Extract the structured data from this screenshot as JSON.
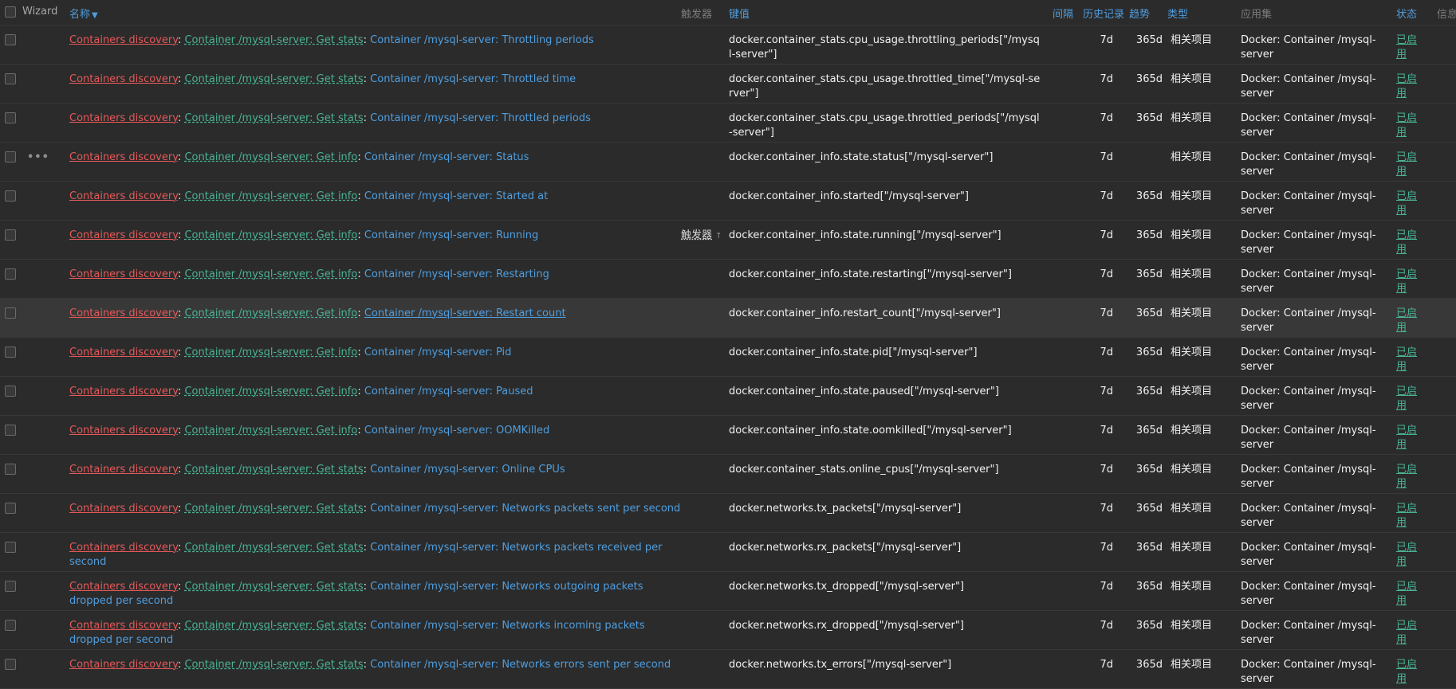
{
  "headers": {
    "wizard": "Wizard",
    "name": "名称",
    "triggers": "触发器",
    "key": "键值",
    "interval": "间隔",
    "history": "历史记录",
    "trends": "趋势",
    "type": "类型",
    "application": "应用集",
    "status": "状态",
    "info": "信息"
  },
  "colors": {
    "discovery": "#e45959",
    "master": "#4ab294",
    "link": "#4f9edf",
    "status": "#4ab294",
    "background": "#2b2b2b"
  },
  "rows": [
    {
      "discovery": "Containers discovery",
      "master": "Container /mysql-server: Get stats",
      "name": "Container /mysql-server: Throttling periods",
      "triggers": "",
      "key": "docker.container_stats.cpu_usage.throttling_periods[\"/mysql-server\"]",
      "history": "7d",
      "trends": "365d",
      "type": "相关项目",
      "app": "Docker: Container /mysql-server",
      "status": "已启用"
    },
    {
      "discovery": "Containers discovery",
      "master": "Container /mysql-server: Get stats",
      "name": "Container /mysql-server: Throttled time",
      "triggers": "",
      "key": "docker.container_stats.cpu_usage.throttled_time[\"/mysql-server\"]",
      "history": "7d",
      "trends": "365d",
      "type": "相关项目",
      "app": "Docker: Container /mysql-server",
      "status": "已启用"
    },
    {
      "discovery": "Containers discovery",
      "master": "Container /mysql-server: Get stats",
      "name": "Container /mysql-server: Throttled periods",
      "triggers": "",
      "key": "docker.container_stats.cpu_usage.throttled_periods[\"/mysql-server\"]",
      "history": "7d",
      "trends": "365d",
      "type": "相关项目",
      "app": "Docker: Container /mysql-server",
      "status": "已启用"
    },
    {
      "discovery": "Containers discovery",
      "master": "Container /mysql-server: Get info",
      "name": "Container /mysql-server: Status",
      "triggers": "",
      "key": "docker.container_info.state.status[\"/mysql-server\"]",
      "history": "7d",
      "trends": "",
      "type": "相关项目",
      "app": "Docker: Container /mysql-server",
      "status": "已启用",
      "dots": "•••"
    },
    {
      "discovery": "Containers discovery",
      "master": "Container /mysql-server: Get info",
      "name": "Container /mysql-server: Started at",
      "triggers": "",
      "key": "docker.container_info.started[\"/mysql-server\"]",
      "history": "7d",
      "trends": "365d",
      "type": "相关项目",
      "app": "Docker: Container /mysql-server",
      "status": "已启用"
    },
    {
      "discovery": "Containers discovery",
      "master": "Container /mysql-server: Get info",
      "name": "Container /mysql-server: Running",
      "triggers": "触发器",
      "triggers_arrow": "↑",
      "key": "docker.container_info.state.running[\"/mysql-server\"]",
      "history": "7d",
      "trends": "365d",
      "type": "相关项目",
      "app": "Docker: Container /mysql-server",
      "status": "已启用"
    },
    {
      "discovery": "Containers discovery",
      "master": "Container /mysql-server: Get info",
      "name": "Container /mysql-server: Restarting",
      "triggers": "",
      "key": "docker.container_info.state.restarting[\"/mysql-server\"]",
      "history": "7d",
      "trends": "365d",
      "type": "相关项目",
      "app": "Docker: Container /mysql-server",
      "status": "已启用"
    },
    {
      "discovery": "Containers discovery",
      "master": "Container /mysql-server: Get info",
      "name": "Container /mysql-server: Restart count",
      "triggers": "",
      "key": "docker.container_info.restart_count[\"/mysql-server\"]",
      "history": "7d",
      "trends": "365d",
      "type": "相关项目",
      "app": "Docker: Container /mysql-server",
      "status": "已启用",
      "hover": true
    },
    {
      "discovery": "Containers discovery",
      "master": "Container /mysql-server: Get info",
      "name": "Container /mysql-server: Pid",
      "triggers": "",
      "key": "docker.container_info.state.pid[\"/mysql-server\"]",
      "history": "7d",
      "trends": "365d",
      "type": "相关项目",
      "app": "Docker: Container /mysql-server",
      "status": "已启用"
    },
    {
      "discovery": "Containers discovery",
      "master": "Container /mysql-server: Get info",
      "name": "Container /mysql-server: Paused",
      "triggers": "",
      "key": "docker.container_info.state.paused[\"/mysql-server\"]",
      "history": "7d",
      "trends": "365d",
      "type": "相关项目",
      "app": "Docker: Container /mysql-server",
      "status": "已启用"
    },
    {
      "discovery": "Containers discovery",
      "master": "Container /mysql-server: Get info",
      "name": "Container /mysql-server: OOMKilled",
      "triggers": "",
      "key": "docker.container_info.state.oomkilled[\"/mysql-server\"]",
      "history": "7d",
      "trends": "365d",
      "type": "相关项目",
      "app": "Docker: Container /mysql-server",
      "status": "已启用"
    },
    {
      "discovery": "Containers discovery",
      "master": "Container /mysql-server: Get stats",
      "name": "Container /mysql-server: Online CPUs",
      "triggers": "",
      "key": "docker.container_stats.online_cpus[\"/mysql-server\"]",
      "history": "7d",
      "trends": "365d",
      "type": "相关项目",
      "app": "Docker: Container /mysql-server",
      "status": "已启用"
    },
    {
      "discovery": "Containers discovery",
      "master": "Container /mysql-server: Get stats",
      "name": "Container /mysql-server: Networks packets sent per second",
      "triggers": "",
      "key": "docker.networks.tx_packets[\"/mysql-server\"]",
      "history": "7d",
      "trends": "365d",
      "type": "相关项目",
      "app": "Docker: Container /mysql-server",
      "status": "已启用"
    },
    {
      "discovery": "Containers discovery",
      "master": "Container /mysql-server: Get stats",
      "name": "Container /mysql-server: Networks packets received per second",
      "triggers": "",
      "key": "docker.networks.rx_packets[\"/mysql-server\"]",
      "history": "7d",
      "trends": "365d",
      "type": "相关项目",
      "app": "Docker: Container /mysql-server",
      "status": "已启用"
    },
    {
      "discovery": "Containers discovery",
      "master": "Container /mysql-server: Get stats",
      "name": "Container /mysql-server: Networks outgoing packets dropped per second",
      "triggers": "",
      "key": "docker.networks.tx_dropped[\"/mysql-server\"]",
      "history": "7d",
      "trends": "365d",
      "type": "相关项目",
      "app": "Docker: Container /mysql-server",
      "status": "已启用"
    },
    {
      "discovery": "Containers discovery",
      "master": "Container /mysql-server: Get stats",
      "name": "Container /mysql-server: Networks incoming packets dropped per second",
      "triggers": "",
      "key": "docker.networks.rx_dropped[\"/mysql-server\"]",
      "history": "7d",
      "trends": "365d",
      "type": "相关项目",
      "app": "Docker: Container /mysql-server",
      "status": "已启用"
    },
    {
      "discovery": "Containers discovery",
      "master": "Container /mysql-server: Get stats",
      "name": "Container /mysql-server: Networks errors sent per second",
      "triggers": "",
      "key": "docker.networks.tx_errors[\"/mysql-server\"]",
      "history": "7d",
      "trends": "365d",
      "type": "相关项目",
      "app": "Docker: Container /mysql-server",
      "status": "已启用"
    }
  ]
}
